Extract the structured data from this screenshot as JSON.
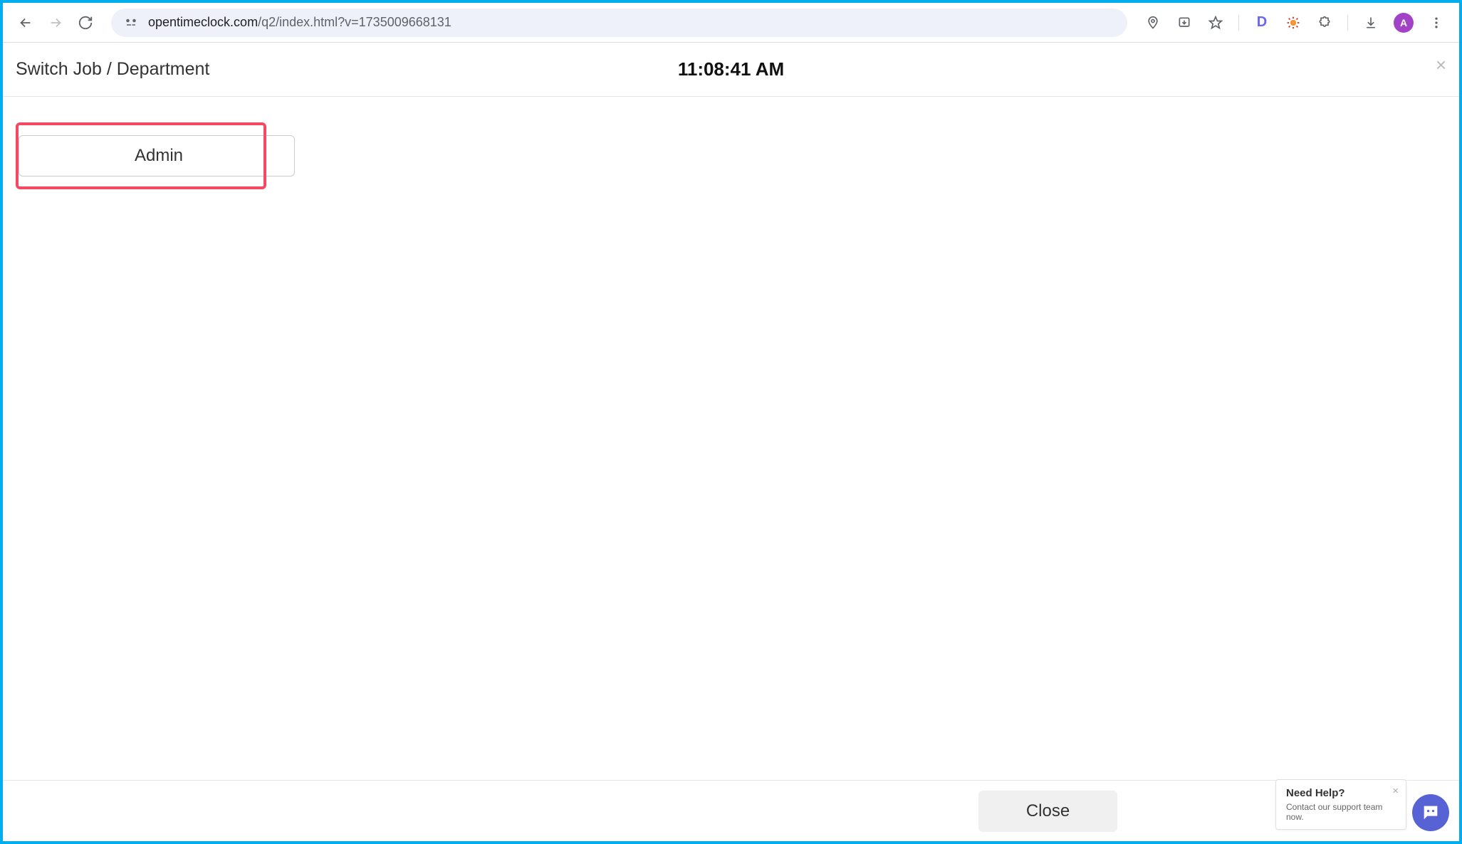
{
  "browser": {
    "url_domain": "opentimeclock.com",
    "url_path": "/q2/index.html?v=1735009668131",
    "avatar_initial": "A"
  },
  "header": {
    "title": "Switch Job / Department",
    "time": "11:08:41 AM",
    "close_label": "×"
  },
  "body": {
    "admin_button_label": "Admin"
  },
  "footer": {
    "close_button_label": "Close"
  },
  "help": {
    "title": "Need Help?",
    "text": "Contact our support team now.",
    "close_label": "×"
  },
  "icons": {
    "d_label": "D"
  }
}
